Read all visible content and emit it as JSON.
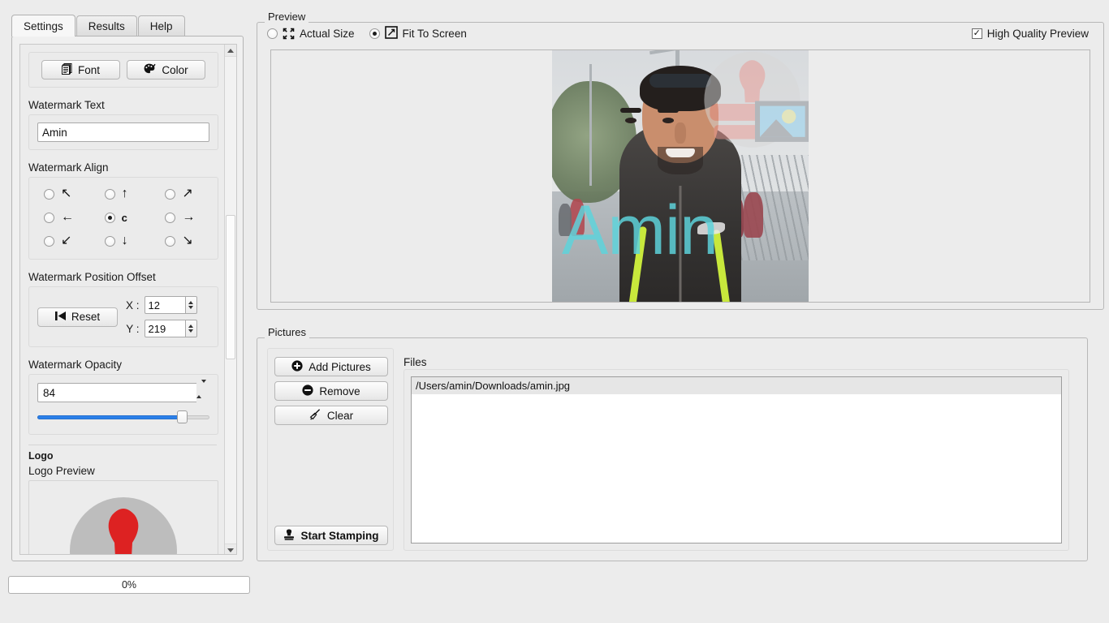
{
  "window": {
    "tabs": [
      {
        "label": "Settings",
        "active": true
      },
      {
        "label": "Results",
        "active": false
      },
      {
        "label": "Help",
        "active": false
      }
    ]
  },
  "settings": {
    "font_button": "Font",
    "color_button": "Color",
    "watermark_text_label": "Watermark Text",
    "watermark_text_value": "Amin",
    "watermark_text_placeholder": "",
    "watermark_align_label": "Watermark Align",
    "align_options": [
      {
        "glyph": "↖",
        "name": "top-left",
        "selected": false
      },
      {
        "glyph": "↑",
        "name": "top-center",
        "selected": false
      },
      {
        "glyph": "↗",
        "name": "top-right",
        "selected": false
      },
      {
        "glyph": "←",
        "name": "middle-left",
        "selected": false
      },
      {
        "glyph": "c",
        "name": "center",
        "selected": true
      },
      {
        "glyph": "→",
        "name": "middle-right",
        "selected": false
      },
      {
        "glyph": "↙",
        "name": "bottom-left",
        "selected": false
      },
      {
        "glyph": "↓",
        "name": "bottom-center",
        "selected": false
      },
      {
        "glyph": "↘",
        "name": "bottom-right",
        "selected": false
      }
    ],
    "position_offset_label": "Watermark Position Offset",
    "reset_button": "Reset",
    "x_label": "X :",
    "x_value": "12",
    "y_label": "Y :",
    "y_value": "219",
    "opacity_label": "Watermark Opacity",
    "opacity_value": "84",
    "opacity_percent": 84,
    "logo_label": "Logo",
    "logo_preview_label": "Logo Preview"
  },
  "progress": {
    "text": "0%",
    "percent": 0
  },
  "preview": {
    "title": "Preview",
    "actual_size_label": "Actual Size",
    "actual_size_selected": false,
    "fit_to_screen_label": "Fit To Screen",
    "fit_to_screen_selected": true,
    "high_quality_label": "High Quality Preview",
    "high_quality_checked": true,
    "high_quality_mark": "✓",
    "watermark_text": "Amin",
    "watermark_color": "#5ed4dc",
    "watermark_opacity": 0.84
  },
  "pictures": {
    "title": "Pictures",
    "add_button": "Add Pictures",
    "remove_button": "Remove",
    "clear_button": "Clear",
    "start_button": "Start Stamping",
    "files_label": "Files",
    "files": [
      "/Users/amin/Downloads/amin.jpg"
    ]
  },
  "colors": {
    "window_bg": "#ececec",
    "panel_border": "#b8b8b8",
    "accent_slider": "#2b7fe8",
    "watermark": "#5ed4dc",
    "logo_red": "#dd2222",
    "logo_blue": "#1ba2ef",
    "logo_yellow": "#ece50f",
    "logo_gray": "#bdbdbd"
  }
}
